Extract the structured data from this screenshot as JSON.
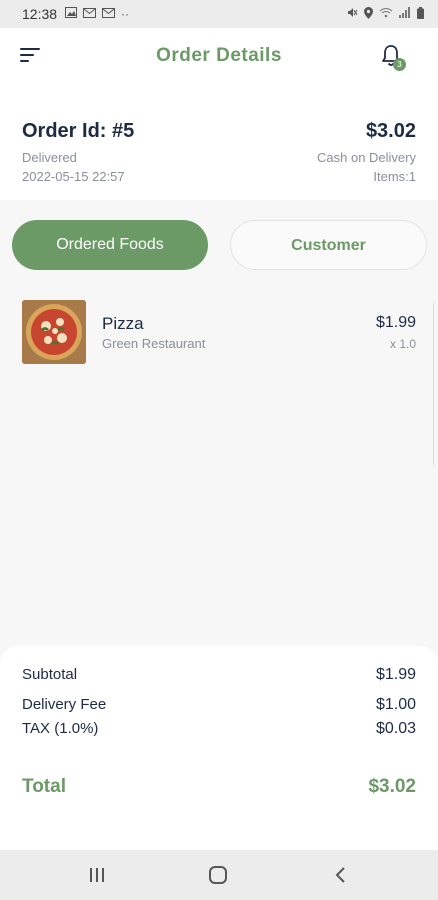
{
  "status_bar": {
    "time": "12:38",
    "left_icons": [
      "image-icon",
      "mail-icon",
      "mail-icon",
      "more-icon"
    ],
    "right_icons": [
      "mute-icon",
      "location-icon",
      "wifi-icon",
      "signal-icon",
      "battery-icon"
    ]
  },
  "header": {
    "title": "Order Details",
    "notification_count": "3"
  },
  "order": {
    "id_label": "Order Id: #5",
    "status": "Delivered",
    "date": "2022-05-15 22:57",
    "total": "$3.02",
    "payment_method": "Cash on Delivery",
    "items_count": "Items:1"
  },
  "tabs": [
    {
      "label": "Ordered Foods",
      "active": true
    },
    {
      "label": "Customer",
      "active": false
    }
  ],
  "foods": [
    {
      "name": "Pizza",
      "restaurant": "Green Restaurant",
      "price": "$1.99",
      "quantity": "x 1.0"
    }
  ],
  "summary": {
    "subtotal_label": "Subtotal",
    "subtotal_value": "$1.99",
    "delivery_label": "Delivery Fee",
    "delivery_value": "$1.00",
    "tax_label": "TAX (1.0%)",
    "tax_value": "$0.03",
    "total_label": "Total",
    "total_value": "$3.02"
  },
  "colors": {
    "accent": "#6b9a66",
    "text_primary": "#1f2a44",
    "text_secondary": "#8a8f99"
  },
  "nav_bar": [
    "recent-apps-icon",
    "home-icon",
    "back-icon"
  ]
}
